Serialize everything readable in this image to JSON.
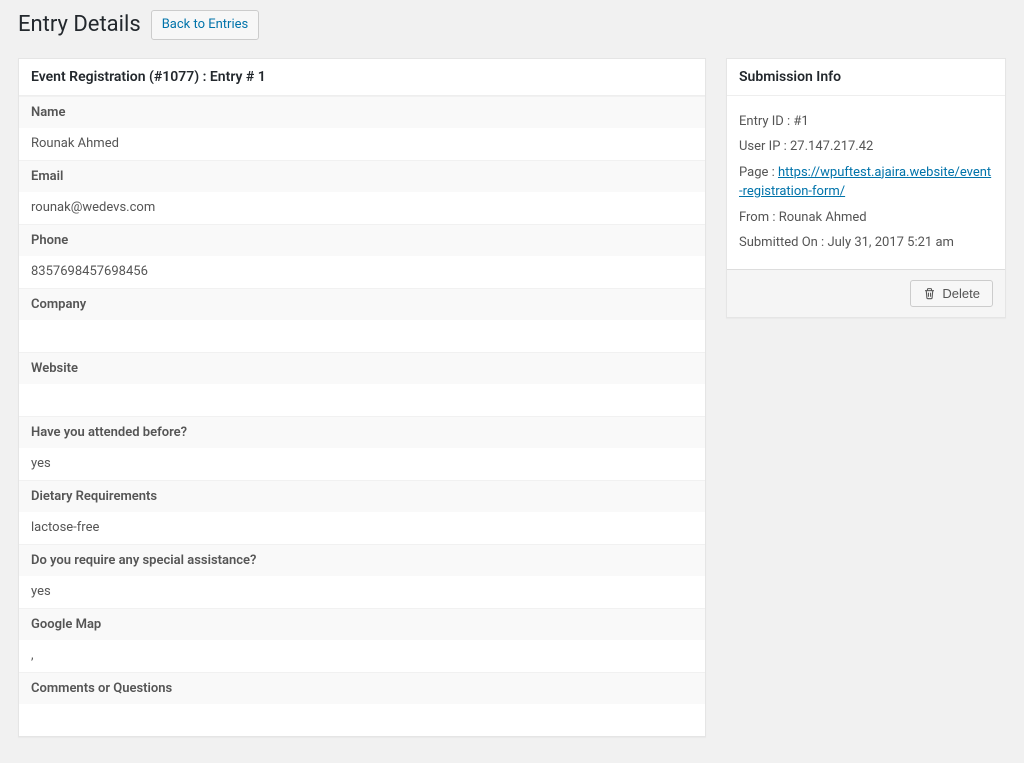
{
  "header": {
    "title": "Entry Details",
    "back_label": "Back to Entries"
  },
  "main": {
    "box_title": "Event Registration (#1077) : Entry # 1",
    "fields": [
      {
        "label": "Name",
        "value": "Rounak Ahmed"
      },
      {
        "label": "Email",
        "value": "rounak@wedevs.com"
      },
      {
        "label": "Phone",
        "value": "8357698457698456"
      },
      {
        "label": "Company",
        "value": ""
      },
      {
        "label": "Website",
        "value": ""
      },
      {
        "label": "Have you attended before?",
        "value": "yes"
      },
      {
        "label": "Dietary Requirements",
        "value": "lactose-free"
      },
      {
        "label": "Do you require any special assistance?",
        "value": "yes"
      },
      {
        "label": "Google Map",
        "value": ","
      },
      {
        "label": "Comments or Questions",
        "value": ""
      }
    ]
  },
  "sidebar": {
    "title": "Submission Info",
    "entry_id_label": "Entry ID : ",
    "entry_id_value": "#1",
    "user_ip_label": "User IP : ",
    "user_ip_value": "27.147.217.42",
    "page_label": "Page : ",
    "page_url": "https://wpuftest.ajaira.website/event-registration-form/",
    "from_label": "From : ",
    "from_value": "Rounak Ahmed",
    "submitted_label": "Submitted On : ",
    "submitted_value": "July 31, 2017 5:21 am",
    "delete_label": "Delete"
  }
}
